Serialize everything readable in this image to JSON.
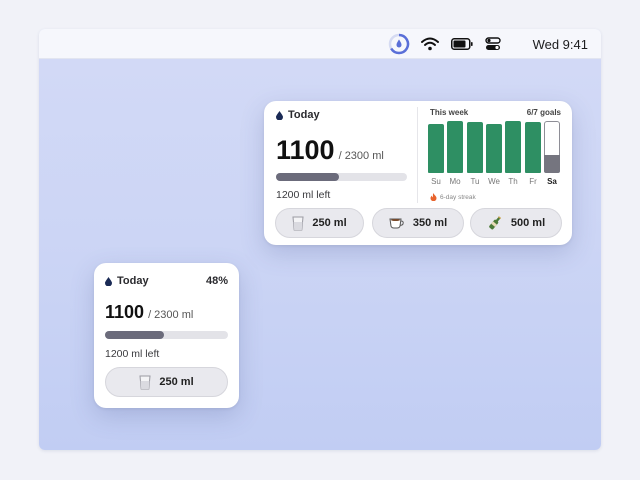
{
  "menubar": {
    "clock": "Wed 9:41",
    "icons": [
      "water-app-icon",
      "wifi-icon",
      "battery-icon",
      "control-center-icon"
    ]
  },
  "large_widget": {
    "title": "Today",
    "amount": "1100",
    "goal": "/ 2300 ml",
    "progress": 0.48,
    "remaining": "1200 ml left",
    "week": {
      "title": "This week",
      "goals": "6/7 goals",
      "days": [
        "Su",
        "Mo",
        "Tu",
        "We",
        "Th",
        "Fr",
        "Sa"
      ],
      "levels": [
        0.94,
        1.0,
        0.98,
        0.94,
        1.0,
        0.98,
        0.35
      ],
      "today_index": 6,
      "streak": "6-day streak",
      "accent": "#2e8f63",
      "today_color": "#75757f"
    },
    "buttons": [
      {
        "label": "250 ml",
        "icon": "glass-icon"
      },
      {
        "label": "350 ml",
        "icon": "coffee-cup-icon"
      },
      {
        "label": "500 ml",
        "icon": "bottle-icon"
      }
    ]
  },
  "small_widget": {
    "title": "Today",
    "percent": "48%",
    "amount": "1100",
    "goal": "/ 2300 ml",
    "progress": 0.48,
    "remaining": "1200 ml left",
    "button": {
      "label": "250 ml",
      "icon": "glass-icon"
    }
  }
}
